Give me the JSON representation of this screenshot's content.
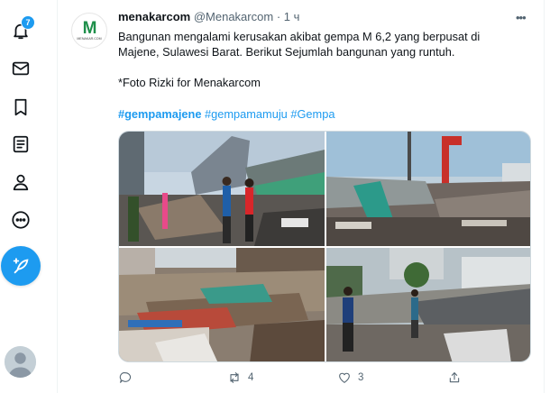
{
  "nav": {
    "notification_count": "7",
    "items": [
      "notifications-icon",
      "messages-icon",
      "bookmarks-icon",
      "lists-icon",
      "profile-icon",
      "more-icon"
    ]
  },
  "tweet": {
    "avatar_logo_main": "M",
    "avatar_logo_sub": "MENAKAR.COM",
    "display_name": "menakarcom",
    "handle": "@Menakarcom",
    "separator": "·",
    "time": "1 ч",
    "more": "•••",
    "text_line_1": "Bangunan mengalami kerusakan akibat gempa M 6,2 yang berpusat di",
    "text_line_2": "Majene, Sulawesi Barat. Berikut Sejumlah bangunan yang runtuh.",
    "credit": "*Foto Rizki for Menakarcom",
    "hashtags": [
      "#gempamajene",
      "#gempamamuju",
      "#Gempa"
    ],
    "photos": [
      "photo-collapsed-building-people",
      "photo-collapsed-roof-debris",
      "photo-rubble-pile",
      "photo-street-debris-people"
    ],
    "retweet_count": "4",
    "like_count": "3"
  },
  "colors": {
    "accent": "#1d9bf0",
    "text": "#0f1419",
    "muted": "#536471"
  }
}
